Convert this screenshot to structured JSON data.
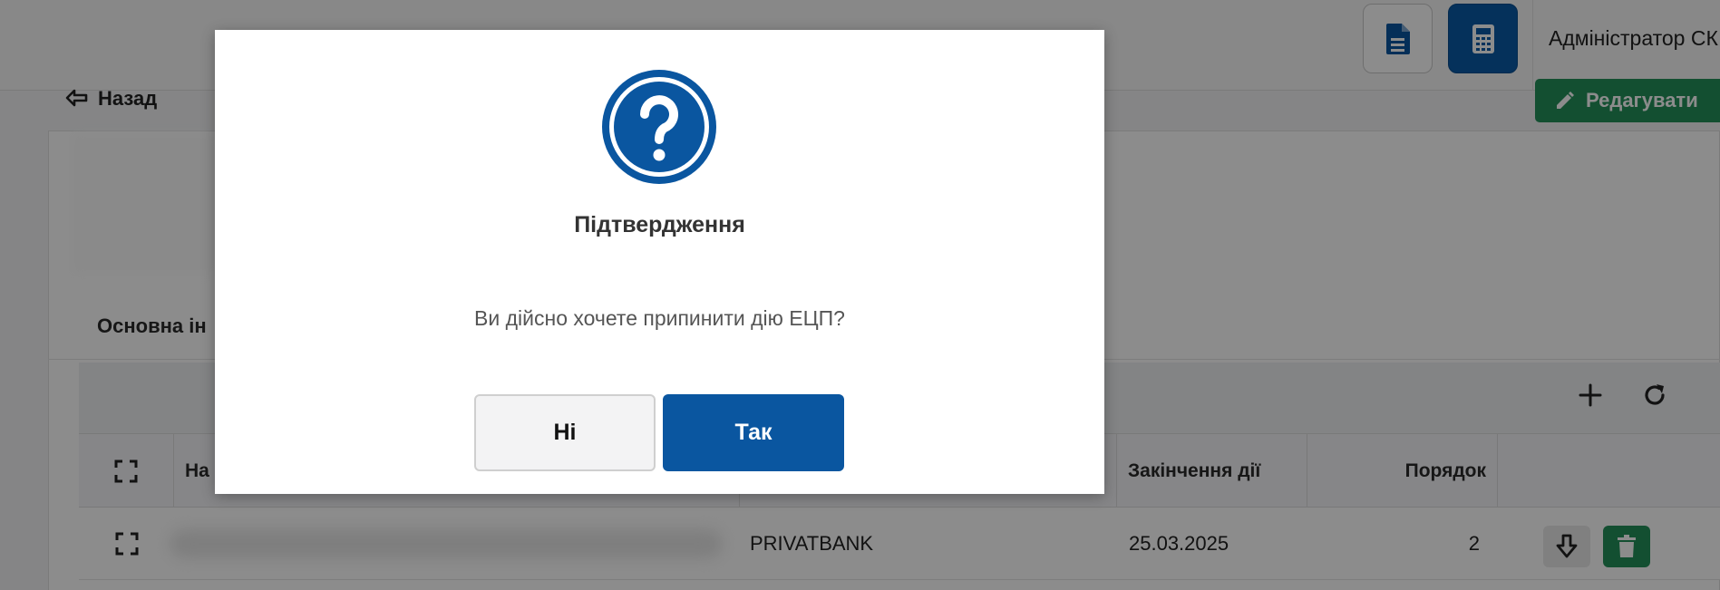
{
  "header": {
    "user_name": "Адміністратор СК",
    "doc_icon": "file-text-icon",
    "calc_icon": "calculator-icon"
  },
  "page": {
    "back_label": "Назад",
    "edit_label": "Редагувати",
    "section_title": "Основна ін"
  },
  "table": {
    "columns": [
      "На",
      "Закінчення дії",
      "Порядок"
    ],
    "rows": [
      {
        "issuer": "PRIVATBANK",
        "expiry": "25.03.2025",
        "order": "2"
      }
    ]
  },
  "modal": {
    "icon": "question-circle-icon",
    "title": "Підтвердження",
    "message": "Ви дійсно хочете припинити дію ЕЦП?",
    "no_label": "Ні",
    "yes_label": "Так"
  },
  "colors": {
    "primary": "#0a56a0",
    "success": "#23915a"
  }
}
